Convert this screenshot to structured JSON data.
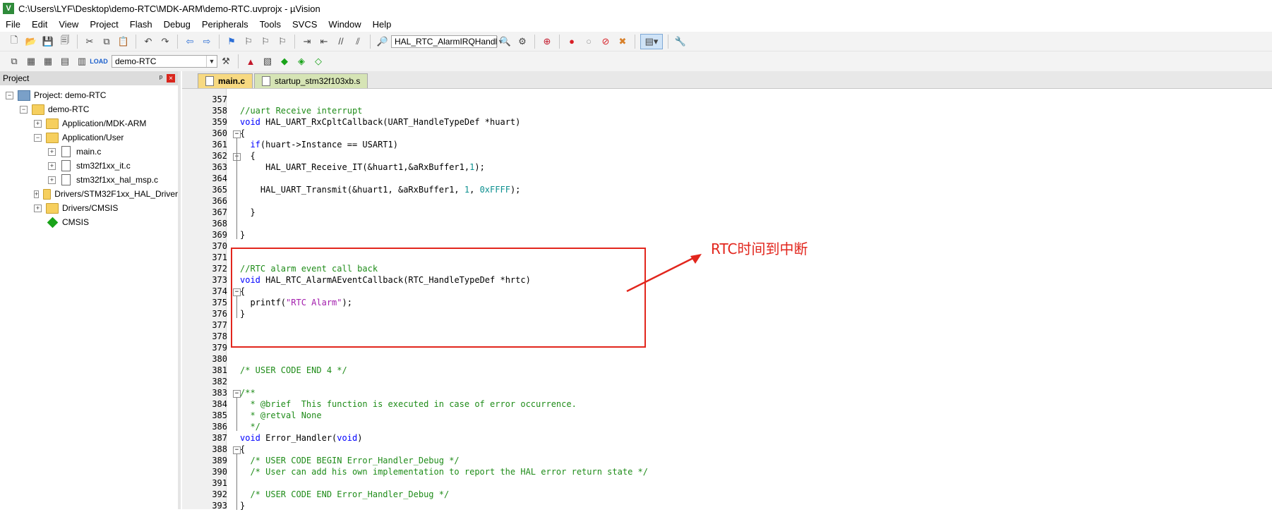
{
  "window": {
    "title": "C:\\Users\\LYF\\Desktop\\demo-RTC\\MDK-ARM\\demo-RTC.uvprojx - µVision"
  },
  "menu": [
    "File",
    "Edit",
    "View",
    "Project",
    "Flash",
    "Debug",
    "Peripherals",
    "Tools",
    "SVCS",
    "Window",
    "Help"
  ],
  "toolbar1": {
    "function_combo": "HAL_RTC_AlarmIRQHandl"
  },
  "toolbar2": {
    "target_combo": "demo-RTC"
  },
  "project_panel": {
    "title": "Project",
    "pin": "ᵖ",
    "close": "×",
    "tree": [
      {
        "label": "Project: demo-RTC",
        "level": 0,
        "expander": "−",
        "icon": "project-icon"
      },
      {
        "label": "demo-RTC",
        "level": 1,
        "expander": "−",
        "icon": "target-icon"
      },
      {
        "label": "Application/MDK-ARM",
        "level": 2,
        "expander": "+",
        "icon": "folder-icon"
      },
      {
        "label": "Application/User",
        "level": 2,
        "expander": "−",
        "icon": "folder-icon"
      },
      {
        "label": "main.c",
        "level": 3,
        "expander": "+",
        "icon": "file-icon"
      },
      {
        "label": "stm32f1xx_it.c",
        "level": 3,
        "expander": "+",
        "icon": "file-icon"
      },
      {
        "label": "stm32f1xx_hal_msp.c",
        "level": 3,
        "expander": "+",
        "icon": "file-icon"
      },
      {
        "label": "Drivers/STM32F1xx_HAL_Driver",
        "level": 2,
        "expander": "+",
        "icon": "folder-icon"
      },
      {
        "label": "Drivers/CMSIS",
        "level": 2,
        "expander": "+",
        "icon": "folder-icon"
      },
      {
        "label": "CMSIS",
        "level": 2,
        "expander": "",
        "icon": "diamond-icon"
      }
    ]
  },
  "editor": {
    "tabs": [
      {
        "label": "main.c",
        "active": true
      },
      {
        "label": "startup_stm32f103xb.s",
        "active": false
      }
    ],
    "lines": [
      {
        "num": "357",
        "fold": "",
        "tokens": []
      },
      {
        "num": "358",
        "fold": "",
        "tokens": [
          {
            "t": "//uart Receive interrupt",
            "c": "comment"
          }
        ]
      },
      {
        "num": "359",
        "fold": "",
        "tokens": [
          {
            "t": "void",
            "c": "kw"
          },
          {
            "t": " HAL_UART_RxCpltCallback(UART_HandleTypeDef *huart)",
            "c": "plain"
          }
        ]
      },
      {
        "num": "360",
        "fold": "−",
        "tokens": [
          {
            "t": "{",
            "c": "plain"
          }
        ]
      },
      {
        "num": "361",
        "fold": "",
        "tokens": [
          {
            "t": "  ",
            "c": "plain"
          },
          {
            "t": "if",
            "c": "kw"
          },
          {
            "t": "(huart->Instance == USART1)",
            "c": "plain"
          }
        ]
      },
      {
        "num": "362",
        "fold": "−",
        "tokens": [
          {
            "t": "  {",
            "c": "plain"
          }
        ]
      },
      {
        "num": "363",
        "fold": "",
        "tokens": [
          {
            "t": "     HAL_UART_Receive_IT(&huart1,&aRxBuffer1,",
            "c": "plain"
          },
          {
            "t": "1",
            "c": "num"
          },
          {
            "t": ");",
            "c": "plain"
          }
        ]
      },
      {
        "num": "364",
        "fold": "",
        "tokens": []
      },
      {
        "num": "365",
        "fold": "",
        "tokens": [
          {
            "t": "    HAL_UART_Transmit(&huart1, &aRxBuffer1, ",
            "c": "plain"
          },
          {
            "t": "1",
            "c": "num"
          },
          {
            "t": ", ",
            "c": "plain"
          },
          {
            "t": "0xFFFF",
            "c": "num"
          },
          {
            "t": ");",
            "c": "plain"
          }
        ]
      },
      {
        "num": "366",
        "fold": "",
        "tokens": []
      },
      {
        "num": "367",
        "fold": "",
        "tokens": [
          {
            "t": "  }",
            "c": "plain"
          }
        ]
      },
      {
        "num": "368",
        "fold": "",
        "tokens": []
      },
      {
        "num": "369",
        "fold": "",
        "tokens": [
          {
            "t": "}",
            "c": "plain"
          }
        ]
      },
      {
        "num": "370",
        "fold": "",
        "tokens": []
      },
      {
        "num": "371",
        "fold": "",
        "tokens": []
      },
      {
        "num": "372",
        "fold": "",
        "tokens": [
          {
            "t": "//RTC alarm event call back",
            "c": "comment"
          }
        ]
      },
      {
        "num": "373",
        "fold": "",
        "tokens": [
          {
            "t": "void",
            "c": "kw"
          },
          {
            "t": " HAL_RTC_AlarmAEventCallback(RTC_HandleTypeDef *hrtc)",
            "c": "plain"
          }
        ]
      },
      {
        "num": "374",
        "fold": "−",
        "tokens": [
          {
            "t": "{",
            "c": "plain"
          }
        ]
      },
      {
        "num": "375",
        "fold": "",
        "tokens": [
          {
            "t": "  printf(",
            "c": "plain"
          },
          {
            "t": "\"RTC Alarm\"",
            "c": "str"
          },
          {
            "t": ");",
            "c": "plain"
          }
        ]
      },
      {
        "num": "376",
        "fold": "",
        "tokens": [
          {
            "t": "}",
            "c": "plain"
          }
        ]
      },
      {
        "num": "377",
        "fold": "",
        "tokens": []
      },
      {
        "num": "378",
        "fold": "",
        "tokens": []
      },
      {
        "num": "379",
        "fold": "",
        "tokens": []
      },
      {
        "num": "380",
        "fold": "",
        "tokens": []
      },
      {
        "num": "381",
        "fold": "",
        "tokens": [
          {
            "t": "/* USER CODE END 4 */",
            "c": "comment"
          }
        ]
      },
      {
        "num": "382",
        "fold": "",
        "tokens": []
      },
      {
        "num": "383",
        "fold": "−",
        "tokens": [
          {
            "t": "/**",
            "c": "comment"
          }
        ]
      },
      {
        "num": "384",
        "fold": "",
        "tokens": [
          {
            "t": "  * @brief  This function is executed in case of error occurrence.",
            "c": "comment"
          }
        ]
      },
      {
        "num": "385",
        "fold": "",
        "tokens": [
          {
            "t": "  * @retval None",
            "c": "comment"
          }
        ]
      },
      {
        "num": "386",
        "fold": "",
        "tokens": [
          {
            "t": "  */",
            "c": "comment"
          }
        ]
      },
      {
        "num": "387",
        "fold": "",
        "tokens": [
          {
            "t": "void",
            "c": "kw"
          },
          {
            "t": " Error_Handler(",
            "c": "plain"
          },
          {
            "t": "void",
            "c": "kw"
          },
          {
            "t": ")",
            "c": "plain"
          }
        ]
      },
      {
        "num": "388",
        "fold": "−",
        "tokens": [
          {
            "t": "{",
            "c": "plain"
          }
        ]
      },
      {
        "num": "389",
        "fold": "",
        "tokens": [
          {
            "t": "  /* USER CODE BEGIN Error_Handler_Debug */",
            "c": "comment"
          }
        ]
      },
      {
        "num": "390",
        "fold": "",
        "tokens": [
          {
            "t": "  /* User can add his own implementation to report the HAL error return state */",
            "c": "comment"
          }
        ]
      },
      {
        "num": "391",
        "fold": "",
        "tokens": []
      },
      {
        "num": "392",
        "fold": "",
        "tokens": [
          {
            "t": "  /* USER CODE END Error_Handler_Debug */",
            "c": "comment"
          }
        ]
      },
      {
        "num": "393",
        "fold": "",
        "tokens": [
          {
            "t": "}",
            "c": "plain"
          }
        ]
      }
    ]
  },
  "annotation": {
    "text": "RTC时间到中断",
    "color": "#e2261d"
  },
  "colors": {
    "comment": "#1f8c19",
    "keyword": "#0000ff",
    "string": "#a31dad",
    "number": "#0b8f8f"
  }
}
